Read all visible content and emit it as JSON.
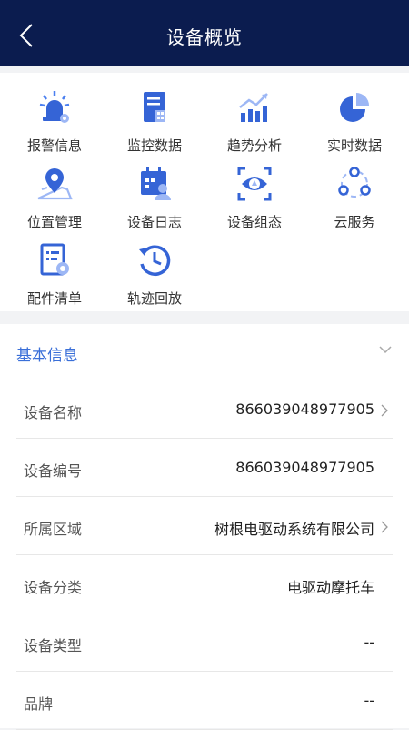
{
  "header": {
    "title": "设备概览"
  },
  "grid": [
    {
      "label": "报警信息",
      "icon": "alarm-light-icon"
    },
    {
      "label": "监控数据",
      "icon": "monitor-document-icon"
    },
    {
      "label": "趋势分析",
      "icon": "trend-chart-icon"
    },
    {
      "label": "实时数据",
      "icon": "pie-chart-icon"
    },
    {
      "label": "位置管理",
      "icon": "location-pin-icon"
    },
    {
      "label": "设备日志",
      "icon": "calendar-user-icon"
    },
    {
      "label": "设备组态",
      "icon": "eye-frame-icon"
    },
    {
      "label": "云服务",
      "icon": "cloud-network-icon"
    },
    {
      "label": "配件清单",
      "icon": "parts-list-icon"
    },
    {
      "label": "轨迹回放",
      "icon": "history-replay-icon"
    }
  ],
  "basic_info": {
    "title": "基本信息",
    "rows": [
      {
        "key": "设备名称",
        "value": "866039048977905"
      },
      {
        "key": "设备编号",
        "value": "866039048977905"
      },
      {
        "key": "所属区域",
        "value": "树根电驱动系统有限公司"
      },
      {
        "key": "设备分类",
        "value": "电驱动摩托车"
      },
      {
        "key": "设备类型",
        "value": "--"
      },
      {
        "key": "品牌",
        "value": "--"
      }
    ]
  },
  "colors": {
    "header_bg": "#0b1c4f",
    "accent": "#3a6fd8"
  }
}
